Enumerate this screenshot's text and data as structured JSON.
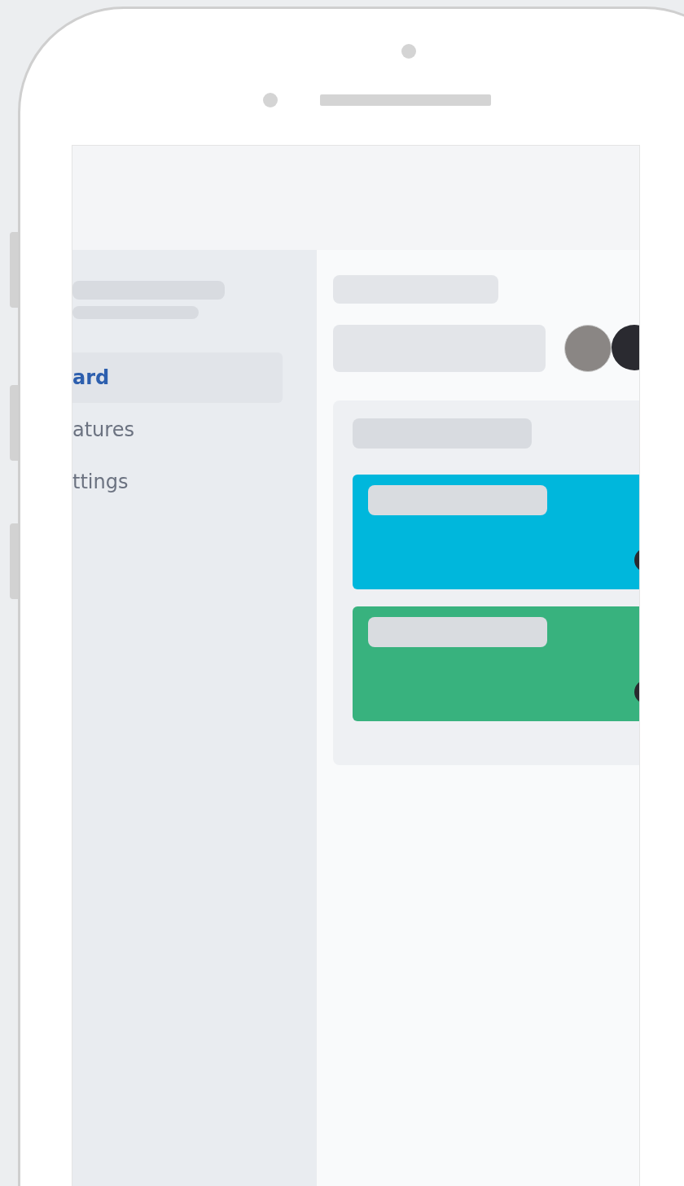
{
  "sidebar": {
    "items": [
      {
        "label": "ard",
        "selected": true
      },
      {
        "label": "atures",
        "selected": false
      },
      {
        "label": "ttings",
        "selected": false
      }
    ]
  },
  "board": {
    "cards": [
      {
        "color": "#00b7dc"
      },
      {
        "color": "#38b27e"
      }
    ]
  }
}
